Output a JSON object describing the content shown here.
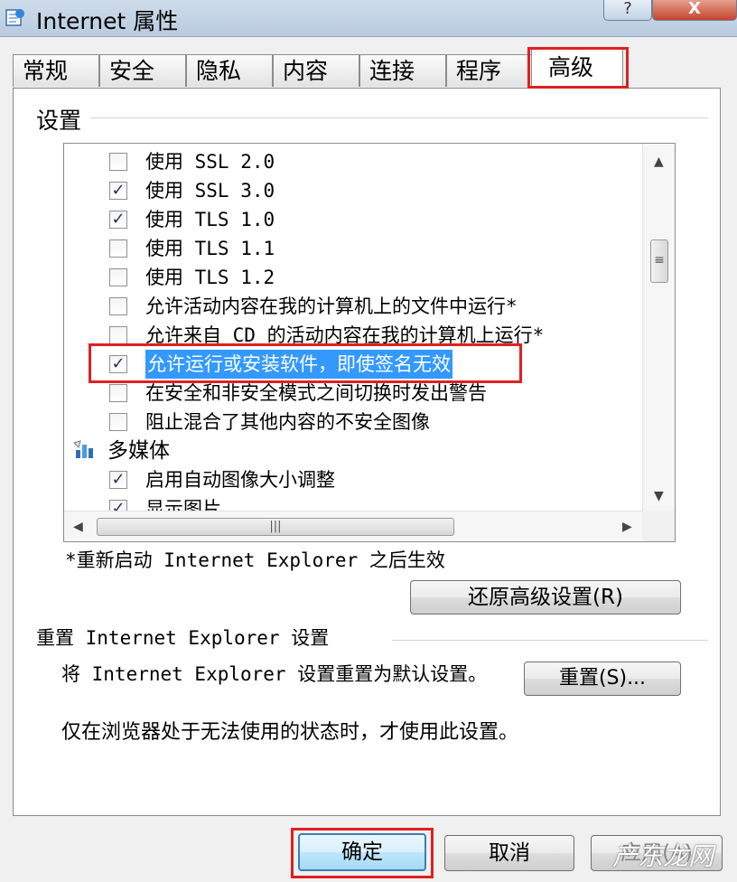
{
  "window": {
    "title": "Internet 属性",
    "help_label": "?",
    "close_label": "X"
  },
  "tabs": [
    {
      "label": "常规"
    },
    {
      "label": "安全"
    },
    {
      "label": "隐私"
    },
    {
      "label": "内容"
    },
    {
      "label": "连接"
    },
    {
      "label": "程序"
    },
    {
      "label": "高级",
      "active": true
    }
  ],
  "settings": {
    "group_title": "设置",
    "items": [
      {
        "label": "使用 SSL 2.0",
        "checked": false
      },
      {
        "label": "使用 SSL 3.0",
        "checked": true
      },
      {
        "label": "使用 TLS 1.0",
        "checked": true
      },
      {
        "label": "使用 TLS 1.1",
        "checked": false
      },
      {
        "label": "使用 TLS 1.2",
        "checked": false
      },
      {
        "label": "允许活动内容在我的计算机上的文件中运行*",
        "checked": false
      },
      {
        "label": "允许来自 CD 的活动内容在我的计算机上运行*",
        "checked": false
      },
      {
        "label": "允许运行或安装软件，即使签名无效",
        "checked": true,
        "selected": true
      },
      {
        "label": "在安全和非安全模式之间切换时发出警告",
        "checked": false
      },
      {
        "label": "阻止混合了其他内容的不安全图像",
        "checked": false
      },
      {
        "label": "多媒体",
        "category": true,
        "icon": "multimedia-category-icon"
      },
      {
        "label": "启用自动图像大小调整",
        "checked": true
      },
      {
        "label": "显示图片",
        "checked": true
      }
    ],
    "restart_note": "*重新启动 Internet Explorer 之后生效",
    "restore_button": "还原高级设置(R)"
  },
  "reset": {
    "group_title": "重置 Internet Explorer 设置",
    "description": "将 Internet Explorer 设置重置为默认设置。",
    "reset_button": "重置(S)...",
    "warning": "仅在浏览器处于无法使用的状态时，才使用此设置。"
  },
  "footer": {
    "ok": "确定",
    "cancel": "取消",
    "apply": "应用(A)"
  },
  "watermark": "产东龙网",
  "colors": {
    "highlight": "#3399ff",
    "annotation_red": "#e02020"
  }
}
